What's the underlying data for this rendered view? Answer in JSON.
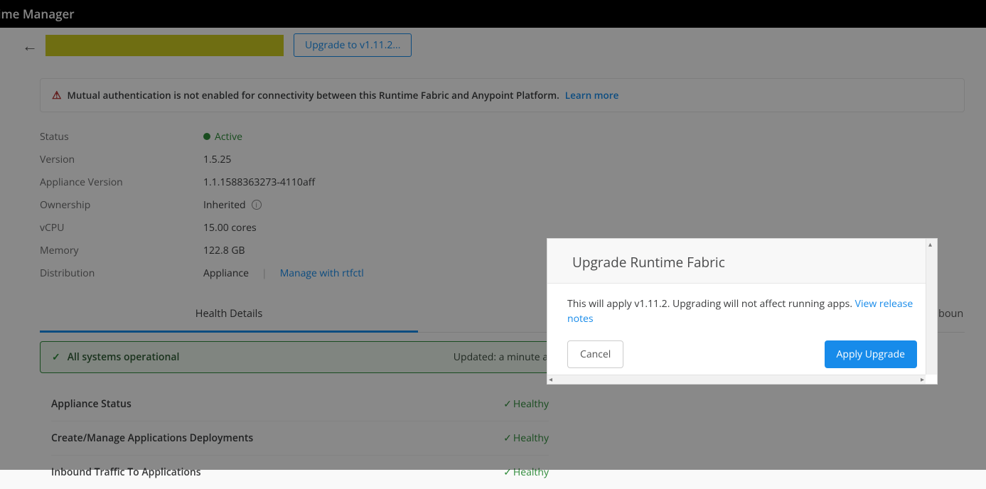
{
  "topbar": {
    "title": "time Manager"
  },
  "header": {
    "upgrade_button": "Upgrade to v1.11.2..."
  },
  "notice": {
    "text": "Mutual authentication is not enabled for connectivity between this Runtime Fabric and Anypoint Platform. ",
    "link": "Learn more"
  },
  "details": {
    "rows": [
      {
        "label": "Status",
        "value": "Active",
        "status": true
      },
      {
        "label": "Version",
        "value": "1.5.25"
      },
      {
        "label": "Appliance Version",
        "value": "1.1.1588363273-4110aff"
      },
      {
        "label": "Ownership",
        "value": "Inherited",
        "info": true
      },
      {
        "label": "vCPU",
        "value": "15.00 cores"
      },
      {
        "label": "Memory",
        "value": "122.8 GB"
      },
      {
        "label": "Distribution",
        "value": "Appliance",
        "manage_link": "Manage with rtfctl"
      }
    ]
  },
  "tabs": {
    "active": "Health Details",
    "right": "Inboun"
  },
  "operational": {
    "text": "All systems operational",
    "updated": "Updated:  a minute a"
  },
  "health": {
    "items": [
      {
        "name": "Appliance Status",
        "status": "Healthy"
      },
      {
        "name": "Create/Manage Applications Deployments",
        "status": "Healthy"
      },
      {
        "name": "Inbound Traffic To Applications",
        "status": "Healthy"
      }
    ]
  },
  "modal": {
    "title": "Upgrade Runtime Fabric",
    "body": "This will apply v1.11.2. Upgrading will not affect running apps. ",
    "link": "View release notes",
    "cancel": "Cancel",
    "apply": "Apply Upgrade"
  }
}
